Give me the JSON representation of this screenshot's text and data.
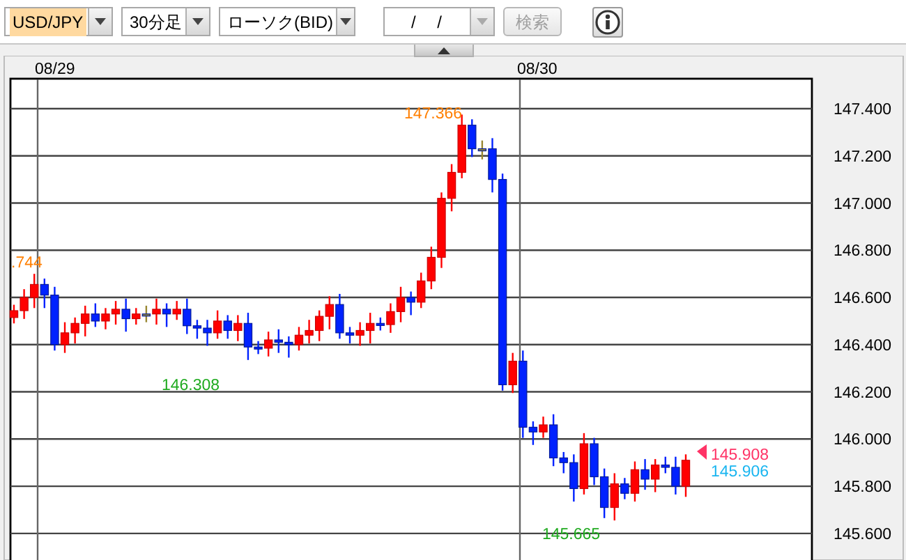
{
  "toolbar": {
    "pair_select": {
      "value": "USD/JPY",
      "focused": true
    },
    "timeframe_select": {
      "value": "30分足"
    },
    "chart_type_select": {
      "value": "ローソク(BID)"
    },
    "date_field": {
      "value": "/ /",
      "dropdown_disabled": true
    },
    "search_button": {
      "label": "検索",
      "disabled": true
    }
  },
  "chart": {
    "date_labels": [
      "08/29",
      "08/30"
    ],
    "price_ticks": [
      "147.400",
      "147.200",
      "147.000",
      "146.800",
      "146.600",
      "146.400",
      "146.200",
      "146.000",
      "145.800",
      "145.600"
    ],
    "annotations": [
      {
        "kind": "high",
        "text": "147.366"
      },
      {
        "kind": "high",
        "text": ".744"
      },
      {
        "kind": "low",
        "text": "146.308"
      },
      {
        "kind": "low",
        "text": "145.665"
      }
    ],
    "current_bid": "145.908",
    "current_ask": "145.906"
  }
}
